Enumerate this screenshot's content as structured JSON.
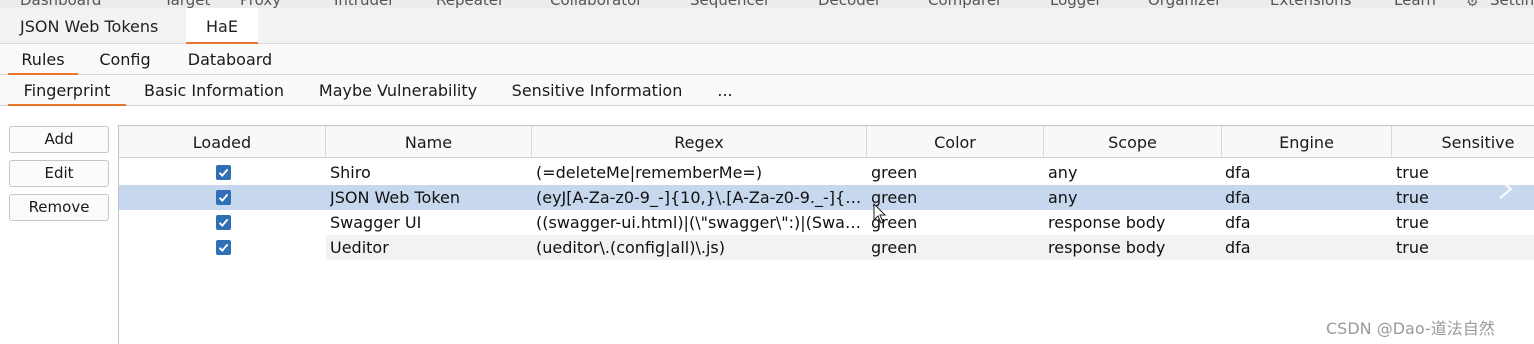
{
  "burp_tabs": {
    "items": [
      {
        "label": "Dashboard"
      },
      {
        "label": "Target"
      },
      {
        "label": "Proxy"
      },
      {
        "label": "Intruder"
      },
      {
        "label": "Repeater"
      },
      {
        "label": "Collaborator"
      },
      {
        "label": "Sequencer"
      },
      {
        "label": "Decoder"
      },
      {
        "label": "Comparer"
      },
      {
        "label": "Logger"
      },
      {
        "label": "Organizer"
      },
      {
        "label": "Extensions"
      },
      {
        "label": "Learn"
      }
    ],
    "settings_label": "Settings"
  },
  "extension_tabs": {
    "items": [
      {
        "label": "JSON Web Tokens"
      },
      {
        "label": "HaE"
      }
    ],
    "active": "HaE"
  },
  "hae_tabs": {
    "items": [
      {
        "label": "Rules"
      },
      {
        "label": "Config"
      },
      {
        "label": "Databoard"
      }
    ],
    "active": "Rules"
  },
  "rule_groups": {
    "items": [
      {
        "label": "Fingerprint"
      },
      {
        "label": "Basic Information"
      },
      {
        "label": "Maybe Vulnerability"
      },
      {
        "label": "Sensitive Information"
      },
      {
        "label": "..."
      }
    ],
    "active": "Fingerprint"
  },
  "actions": {
    "add_label": "Add",
    "edit_label": "Edit",
    "remove_label": "Remove"
  },
  "rules_table": {
    "columns": [
      "Loaded",
      "Name",
      "Regex",
      "Color",
      "Scope",
      "Engine",
      "Sensitive"
    ],
    "rows": [
      {
        "loaded": true,
        "name": "Shiro",
        "regex": "(=deleteMe|rememberMe=)",
        "color": "green",
        "scope": "any",
        "engine": "dfa",
        "sensitive": "true"
      },
      {
        "loaded": true,
        "name": "JSON Web Token",
        "regex": "(eyJ[A-Za-z0-9_-]{10,}\\.[A-Za-z0-9._-]{1...",
        "color": "green",
        "scope": "any",
        "engine": "dfa",
        "sensitive": "true"
      },
      {
        "loaded": true,
        "name": "Swagger UI",
        "regex": "((swagger-ui.html)|(\\\"swagger\\\":)|(Swag...",
        "color": "green",
        "scope": "response body",
        "engine": "dfa",
        "sensitive": "true"
      },
      {
        "loaded": true,
        "name": "Ueditor",
        "regex": "(ueditor\\.(config|all)\\.js)",
        "color": "green",
        "scope": "response body",
        "engine": "dfa",
        "sensitive": "true"
      }
    ],
    "selected_row": 1
  },
  "watermark": "CSDN @Dao-道法自然",
  "colors": {
    "accent": "#e8762c",
    "selection": "#c7d8ee",
    "checkbox": "#2f6fb5"
  }
}
